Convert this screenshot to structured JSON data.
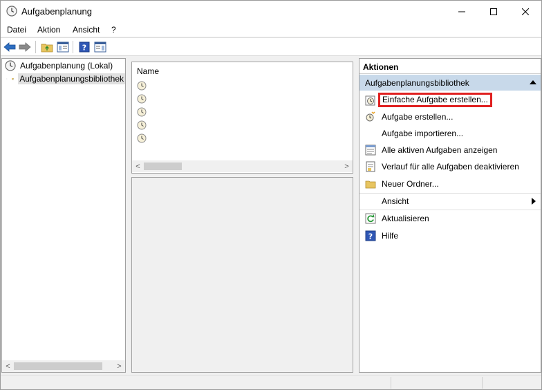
{
  "window": {
    "title": "Aufgabenplanung",
    "controls": {
      "minimize": "minimize",
      "maximize": "maximize",
      "close": "close"
    }
  },
  "menu": [
    "Datei",
    "Aktion",
    "Ansicht",
    "?"
  ],
  "toolbar": {
    "buttons": [
      "back-arrow-icon",
      "forward-arrow-icon",
      "folder-up-icon",
      "show-hide-tree-icon",
      "help-icon",
      "show-hide-action-pane-icon"
    ]
  },
  "tree": {
    "root": "Aufgabenplanung (Lokal)",
    "child": "Aufgabenplanungsbibliothek"
  },
  "task_list": {
    "column_header": "Name",
    "rows": [
      "",
      "",
      "",
      "",
      ""
    ]
  },
  "actions": {
    "header": "Aktionen",
    "section": "Aufgabenplanungsbibliothek",
    "items": [
      {
        "label": "Einfache Aufgabe erstellen...",
        "icon": "create-basic-task-icon",
        "highlighted": true
      },
      {
        "label": "Aufgabe erstellen...",
        "icon": "create-task-icon"
      },
      {
        "label": "Aufgabe importieren...",
        "icon": ""
      },
      {
        "label": "Alle aktiven Aufgaben anzeigen",
        "icon": "active-tasks-icon"
      },
      {
        "label": "Verlauf für alle Aufgaben deaktivieren",
        "icon": "history-icon"
      },
      {
        "label": "Neuer Ordner...",
        "icon": "new-folder-icon"
      },
      {
        "label": "Ansicht",
        "icon": "",
        "submenu": true
      },
      {
        "label": "Aktualisieren",
        "icon": "refresh-icon"
      },
      {
        "label": "Hilfe",
        "icon": "help-icon"
      }
    ]
  },
  "colors": {
    "section_header": "#c8d9ea",
    "highlight_border": "#e02020",
    "accent_blue": "#2e6ec1"
  }
}
